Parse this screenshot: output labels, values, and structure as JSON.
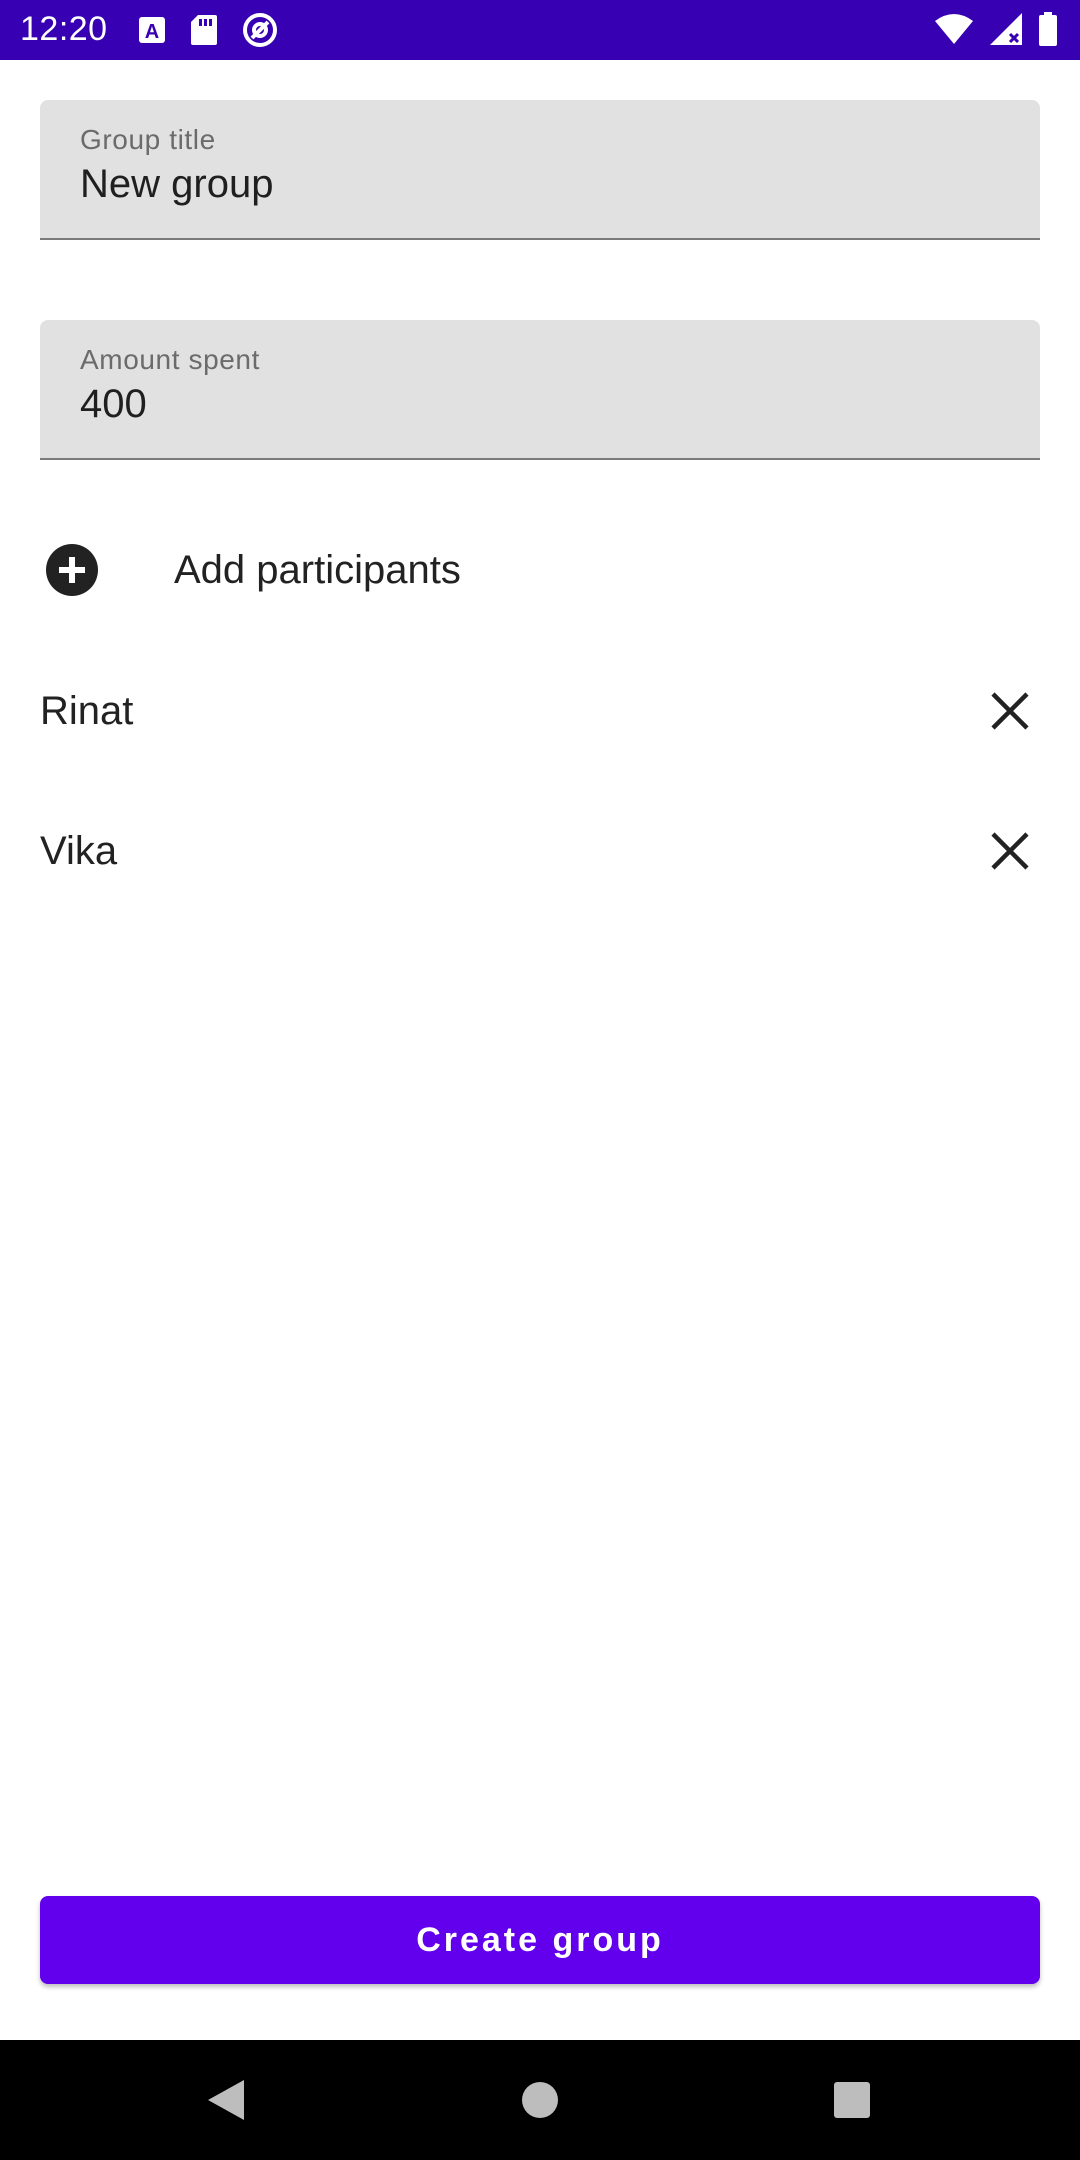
{
  "status_bar": {
    "time": "12:20",
    "icons": [
      "a-icon",
      "sd-card-icon",
      "at-sign-icon",
      "wifi-icon",
      "signal-icon",
      "battery-icon"
    ]
  },
  "form": {
    "group_title": {
      "label": "Group title",
      "value": "New group"
    },
    "amount_spent": {
      "label": "Amount spent",
      "value": "400"
    }
  },
  "add_participants": {
    "label": "Add participants",
    "icon": "add-circle-icon"
  },
  "participants": [
    {
      "name": "Rinat",
      "remove_icon": "close-icon"
    },
    {
      "name": "Vika",
      "remove_icon": "close-icon"
    }
  ],
  "create_button": {
    "label": "Create group"
  },
  "navigation": {
    "back": "back-icon",
    "home": "home-icon",
    "recents": "recents-icon"
  },
  "colors": {
    "status_bar": "#3700b3",
    "primary": "#6200ee",
    "field_background": "#e1e1e1",
    "nav_bar": "#000000"
  }
}
